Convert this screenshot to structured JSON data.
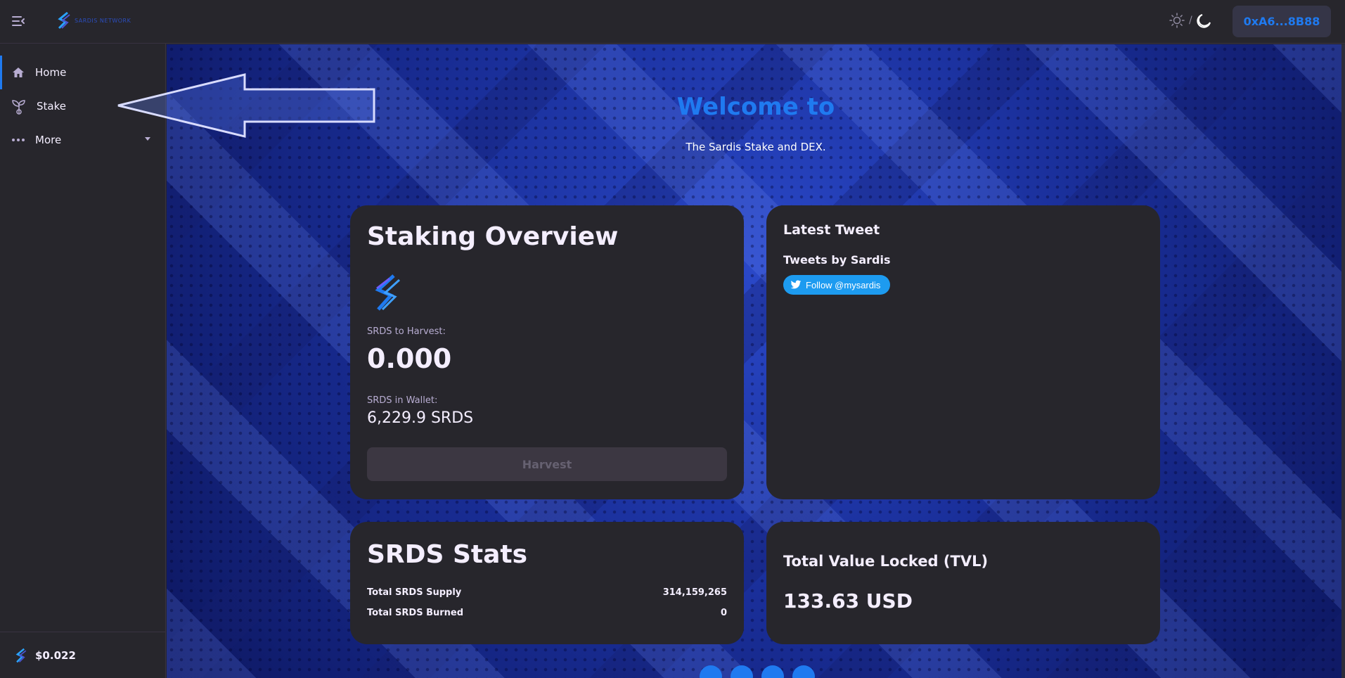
{
  "header": {
    "logo_text": "SARDIS NETWORK",
    "theme_separator": "/",
    "wallet_label": "0xA6...8B88"
  },
  "sidebar": {
    "items": [
      {
        "label": "Home",
        "icon": "home-icon"
      },
      {
        "label": "Stake",
        "icon": "sprout-icon"
      },
      {
        "label": "More",
        "icon": "more-icon"
      }
    ],
    "price": "$0.022"
  },
  "hero": {
    "title": "Welcome to",
    "subtitle": "The Sardis Stake and DEX."
  },
  "staking": {
    "title": "Staking Overview",
    "harvest_label": "SRDS to Harvest:",
    "harvest_value": "0.000",
    "wallet_label": "SRDS in Wallet:",
    "wallet_value": "6,229.9 SRDS",
    "button": "Harvest"
  },
  "tweet": {
    "title": "Latest Tweet",
    "by": "Tweets by Sardis",
    "follow": "Follow @mysardis"
  },
  "stats": {
    "title": "SRDS Stats",
    "rows": [
      {
        "label": "Total SRDS Supply",
        "value": "314,159,265"
      },
      {
        "label": "Total SRDS Burned",
        "value": "0"
      }
    ]
  },
  "tvl": {
    "title": "Total Value Locked (TVL)",
    "value": "133.63 USD"
  },
  "colors": {
    "accent": "#1f7af0",
    "card": "#27262c",
    "twitter": "#1d9bf0"
  }
}
